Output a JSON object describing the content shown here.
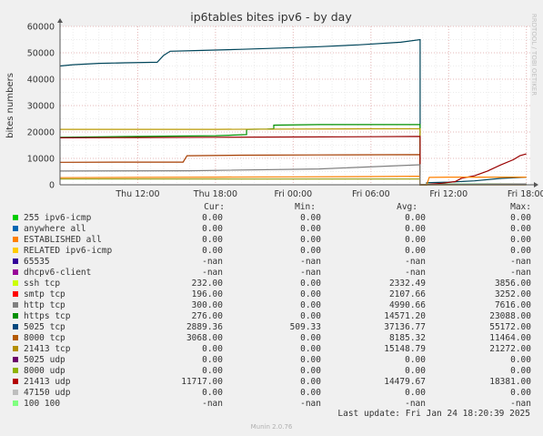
{
  "chart_data": {
    "type": "line",
    "title": "ip6tables bites ipv6 - by day",
    "ylabel": "bites numbers",
    "side_text": "RRDTOOL / TOBI OETIKER",
    "ylim": [
      0,
      60000
    ],
    "y_ticks": [
      0,
      10000,
      20000,
      30000,
      40000,
      50000,
      60000
    ],
    "x_ticks": [
      {
        "label": "Thu 12:00",
        "t": 6
      },
      {
        "label": "Thu 18:00",
        "t": 12
      },
      {
        "label": "Fri 00:00",
        "t": 18
      },
      {
        "label": "Fri 06:00",
        "t": 24
      },
      {
        "label": "Fri 12:00",
        "t": 30
      },
      {
        "label": "Fri 18:00",
        "t": 36
      }
    ],
    "x_range": [
      0,
      36.3
    ],
    "grid": true,
    "series": [
      {
        "name": "5025 tcp",
        "color": "#00455A",
        "points": [
          [
            0,
            45000
          ],
          [
            1,
            45500
          ],
          [
            3,
            46000
          ],
          [
            5,
            46200
          ],
          [
            7.5,
            46400
          ],
          [
            8,
            49000
          ],
          [
            8.5,
            50600
          ],
          [
            11,
            50900
          ],
          [
            14,
            51300
          ],
          [
            17,
            51800
          ],
          [
            20,
            52300
          ],
          [
            23,
            53000
          ],
          [
            26.3,
            54000
          ],
          [
            27.8,
            55000
          ],
          [
            27.8,
            0
          ],
          [
            28.3,
            0
          ],
          [
            28.3,
            800
          ],
          [
            30,
            1000
          ],
          [
            32,
            1500
          ],
          [
            34,
            2400
          ],
          [
            36,
            2900
          ]
        ]
      },
      {
        "name": "https tcp",
        "color": "#008F00",
        "points": [
          [
            0,
            18000
          ],
          [
            6,
            18300
          ],
          [
            12,
            18600
          ],
          [
            14.4,
            19000
          ],
          [
            14.4,
            21000
          ],
          [
            16,
            21100
          ],
          [
            16.5,
            21200
          ],
          [
            16.5,
            22600
          ],
          [
            20,
            22800
          ],
          [
            27.8,
            22800
          ],
          [
            27.8,
            0
          ],
          [
            28.3,
            0
          ],
          [
            28.3,
            200
          ],
          [
            36,
            300
          ]
        ]
      },
      {
        "name": "21413 tcp",
        "color": "#B89800",
        "points": [
          [
            0,
            21000
          ],
          [
            6,
            21000
          ],
          [
            12,
            21000
          ],
          [
            18,
            21100
          ],
          [
            24,
            21200
          ],
          [
            27.8,
            21200
          ],
          [
            27.8,
            0
          ],
          [
            28.3,
            0
          ],
          [
            36,
            300
          ]
        ]
      },
      {
        "name": "8000 tcp",
        "color": "#A63D00",
        "points": [
          [
            0,
            8500
          ],
          [
            5,
            8600
          ],
          [
            9.5,
            8600
          ],
          [
            9.8,
            11000
          ],
          [
            14,
            11200
          ],
          [
            20,
            11300
          ],
          [
            27.8,
            11400
          ],
          [
            27.8,
            0
          ],
          [
            28.3,
            0
          ],
          [
            36,
            0
          ]
        ]
      },
      {
        "name": "21413 udp",
        "color": "#990000",
        "points": [
          [
            0,
            17800
          ],
          [
            6,
            17900
          ],
          [
            12,
            18000
          ],
          [
            18,
            18100
          ],
          [
            24,
            18200
          ],
          [
            27.8,
            18300
          ],
          [
            27.8,
            0
          ],
          [
            28.3,
            0
          ],
          [
            28.7,
            300
          ],
          [
            29.5,
            600
          ],
          [
            30.5,
            1200
          ],
          [
            31,
            2500
          ],
          [
            32,
            3400
          ],
          [
            33,
            5200
          ],
          [
            34,
            7500
          ],
          [
            35,
            9500
          ],
          [
            35.5,
            11000
          ],
          [
            36,
            11700
          ]
        ]
      },
      {
        "name": "smtp tcp",
        "color": "#FF8000",
        "points": [
          [
            0,
            2700
          ],
          [
            6,
            2800
          ],
          [
            12,
            2900
          ],
          [
            18,
            3000
          ],
          [
            24,
            3100
          ],
          [
            27.8,
            3250
          ],
          [
            27.8,
            0
          ],
          [
            28.3,
            0
          ],
          [
            28.5,
            2800
          ],
          [
            30,
            2900
          ],
          [
            36,
            2900
          ]
        ]
      },
      {
        "name": "8000 udp",
        "color": "#9FA625",
        "points": [
          [
            0,
            2200
          ],
          [
            27.8,
            2200
          ],
          [
            27.8,
            0
          ],
          [
            36,
            0
          ]
        ]
      },
      {
        "name": "http tcp",
        "color": "#7F7F7F",
        "points": [
          [
            0,
            5200
          ],
          [
            10,
            5300
          ],
          [
            20,
            6000
          ],
          [
            27.8,
            7600
          ],
          [
            27.8,
            0
          ],
          [
            36,
            300
          ]
        ]
      }
    ]
  },
  "legend": {
    "headers": {
      "cur": "Cur:",
      "min": "Min:",
      "avg": "Avg:",
      "max": "Max:"
    },
    "rows": [
      {
        "name": "255 ipv6-icmp",
        "color": "#00CC00",
        "cur": "0.00",
        "min": "0.00",
        "avg": "0.00",
        "max": "0.00"
      },
      {
        "name": "anywhere all",
        "color": "#0066B3",
        "cur": "0.00",
        "min": "0.00",
        "avg": "0.00",
        "max": "0.00"
      },
      {
        "name": "ESTABLISHED all",
        "color": "#FF8000",
        "cur": "0.00",
        "min": "0.00",
        "avg": "0.00",
        "max": "0.00"
      },
      {
        "name": "RELATED ipv6-icmp",
        "color": "#FFCC00",
        "cur": "0.00",
        "min": "0.00",
        "avg": "0.00",
        "max": "0.00"
      },
      {
        "name": "65535",
        "color": "#330099",
        "cur": "-nan",
        "min": "-nan",
        "avg": "-nan",
        "max": "-nan"
      },
      {
        "name": "dhcpv6-client",
        "color": "#990099",
        "cur": "-nan",
        "min": "-nan",
        "avg": "-nan",
        "max": "-nan"
      },
      {
        "name": "ssh tcp",
        "color": "#CCFF00",
        "cur": "232.00",
        "min": "0.00",
        "avg": "2332.49",
        "max": "3856.00"
      },
      {
        "name": "smtp tcp",
        "color": "#FF0000",
        "cur": "196.00",
        "min": "0.00",
        "avg": "2107.66",
        "max": "3252.00"
      },
      {
        "name": "http tcp",
        "color": "#808080",
        "cur": "300.00",
        "min": "0.00",
        "avg": "4990.66",
        "max": "7616.00"
      },
      {
        "name": "https tcp",
        "color": "#008F00",
        "cur": "276.00",
        "min": "0.00",
        "avg": "14571.20",
        "max": "23088.00"
      },
      {
        "name": "5025 tcp",
        "color": "#00487D",
        "cur": "2889.36",
        "min": "509.33",
        "avg": "37136.77",
        "max": "55172.00"
      },
      {
        "name": "8000 tcp",
        "color": "#B35A00",
        "cur": "3068.00",
        "min": "0.00",
        "avg": "8185.32",
        "max": "11464.00"
      },
      {
        "name": "21413 tcp",
        "color": "#B38F00",
        "cur": "0.00",
        "min": "0.00",
        "avg": "15148.79",
        "max": "21272.00"
      },
      {
        "name": "5025 udp",
        "color": "#6B006B",
        "cur": "0.00",
        "min": "0.00",
        "avg": "0.00",
        "max": "0.00"
      },
      {
        "name": "8000 udp",
        "color": "#8FB300",
        "cur": "0.00",
        "min": "0.00",
        "avg": "0.00",
        "max": "0.00"
      },
      {
        "name": "21413 udp",
        "color": "#B30000",
        "cur": "11717.00",
        "min": "0.00",
        "avg": "14479.67",
        "max": "18381.00"
      },
      {
        "name": "47150 udp",
        "color": "#BEBEBE",
        "cur": "0.00",
        "min": "0.00",
        "avg": "0.00",
        "max": "0.00"
      },
      {
        "name": "100 100",
        "color": "#80FF80",
        "cur": "-nan",
        "min": "-nan",
        "avg": "-nan",
        "max": "-nan"
      }
    ]
  },
  "footer": {
    "last_update": "Last update: Fri Jan 24 18:20:39 2025",
    "munin_version": "Munin 2.0.76"
  }
}
